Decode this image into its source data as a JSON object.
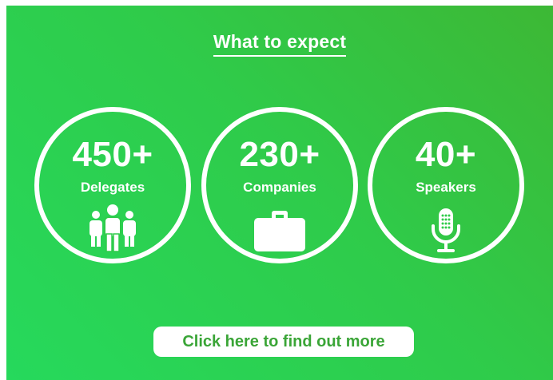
{
  "heading": "What to expect",
  "stats": [
    {
      "value": "450+",
      "label": "Delegates",
      "icon": "people-icon"
    },
    {
      "value": "230+",
      "label": "Companies",
      "icon": "briefcase-icon"
    },
    {
      "value": "40+",
      "label": "Speakers",
      "icon": "microphone-icon"
    }
  ],
  "cta_label": "Click here to find out more",
  "colors": {
    "background": "#2fcb4a",
    "foreground": "#ffffff",
    "cta_text": "#3aa537"
  }
}
